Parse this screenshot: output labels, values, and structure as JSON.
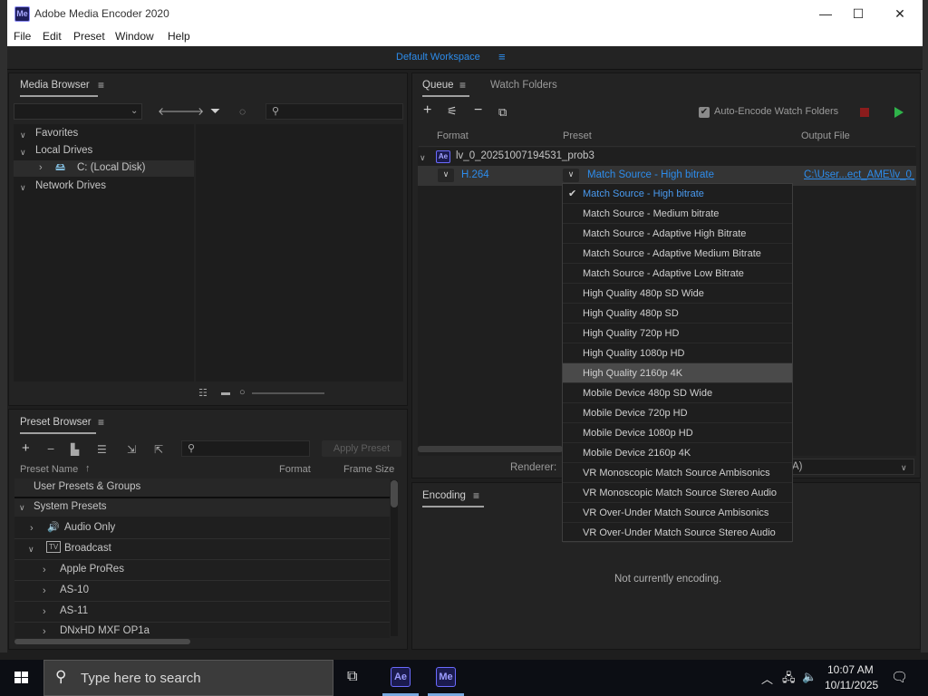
{
  "window": {
    "app_icon": "Me",
    "title": "Adobe Media Encoder 2020",
    "controls": {
      "minimize": "—",
      "maximize": "☐",
      "close": "✕"
    }
  },
  "menu": [
    "File",
    "Edit",
    "Preset",
    "Window",
    "Help"
  ],
  "workspace": {
    "label": "Default Workspace",
    "menu_icon": "≡"
  },
  "media_browser": {
    "title": "Media Browser",
    "menu_icon": "≡",
    "tree": [
      {
        "label": "Favorites"
      },
      {
        "label": "Local Drives"
      },
      {
        "label": "C: (Local Disk)"
      },
      {
        "label": "Network Drives"
      }
    ]
  },
  "preset_browser": {
    "title": "Preset Browser",
    "menu_icon": "≡",
    "apply_button": "Apply Preset",
    "columns": {
      "name": "Preset Name",
      "sort_icon": "↑",
      "format": "Format",
      "frame_size": "Frame Size"
    },
    "rows": [
      {
        "label": "User Presets & Groups"
      },
      {
        "label": "System Presets"
      },
      {
        "label": "Audio Only"
      },
      {
        "label": "Broadcast"
      },
      {
        "label": "Apple ProRes"
      },
      {
        "label": "AS-10"
      },
      {
        "label": "AS-11"
      },
      {
        "label": "DNxHD MXF OP1a"
      }
    ]
  },
  "queue": {
    "tab_queue": "Queue",
    "tab_watch": "Watch Folders",
    "menu_icon": "≡",
    "auto_encode_label": "Auto-Encode Watch Folders",
    "auto_encode_checked": true,
    "columns": {
      "format": "Format",
      "preset": "Preset",
      "output": "Output File"
    },
    "item": {
      "badge": "Ae",
      "name": "lv_0_20251007194531_prob3",
      "format": "H.264",
      "preset": "Match Source - High bitrate",
      "output": "C:\\User...ect_AME\\lv_0_"
    },
    "renderer_label": "Renderer:",
    "renderer_value_suffix": "A)"
  },
  "preset_dropdown": {
    "selected_index": 0,
    "hover_index": 9,
    "check_icon": "✔",
    "options": [
      "Match Source - High bitrate",
      "Match Source - Medium bitrate",
      "Match Source - Adaptive High Bitrate",
      "Match Source - Adaptive Medium Bitrate",
      "Match Source - Adaptive Low Bitrate",
      "High Quality 480p SD Wide",
      "High Quality 480p SD",
      "High Quality 720p HD",
      "High Quality 1080p HD",
      "High Quality 2160p 4K",
      "Mobile Device 480p SD Wide",
      "Mobile Device 720p HD",
      "Mobile Device 1080p HD",
      "Mobile Device 2160p 4K",
      "VR Monoscopic Match Source Ambisonics",
      "VR Monoscopic Match Source Stereo Audio",
      "VR Over-Under Match Source Ambisonics",
      "VR Over-Under Match Source Stereo Audio"
    ]
  },
  "encoding": {
    "title": "Encoding",
    "menu_icon": "≡",
    "status": "Not currently encoding."
  },
  "taskbar": {
    "search_placeholder": "Type here to search",
    "apps": [
      {
        "label": "Ae"
      },
      {
        "label": "Me"
      }
    ],
    "time": "10:07 AM",
    "date": "10/11/2025"
  },
  "colors": {
    "accent_blue": "#2d8ceb",
    "panel_bg": "#232323",
    "hover_row": "#4a4a4a",
    "play_green": "#2fb34a",
    "stop_red": "#a02020"
  }
}
